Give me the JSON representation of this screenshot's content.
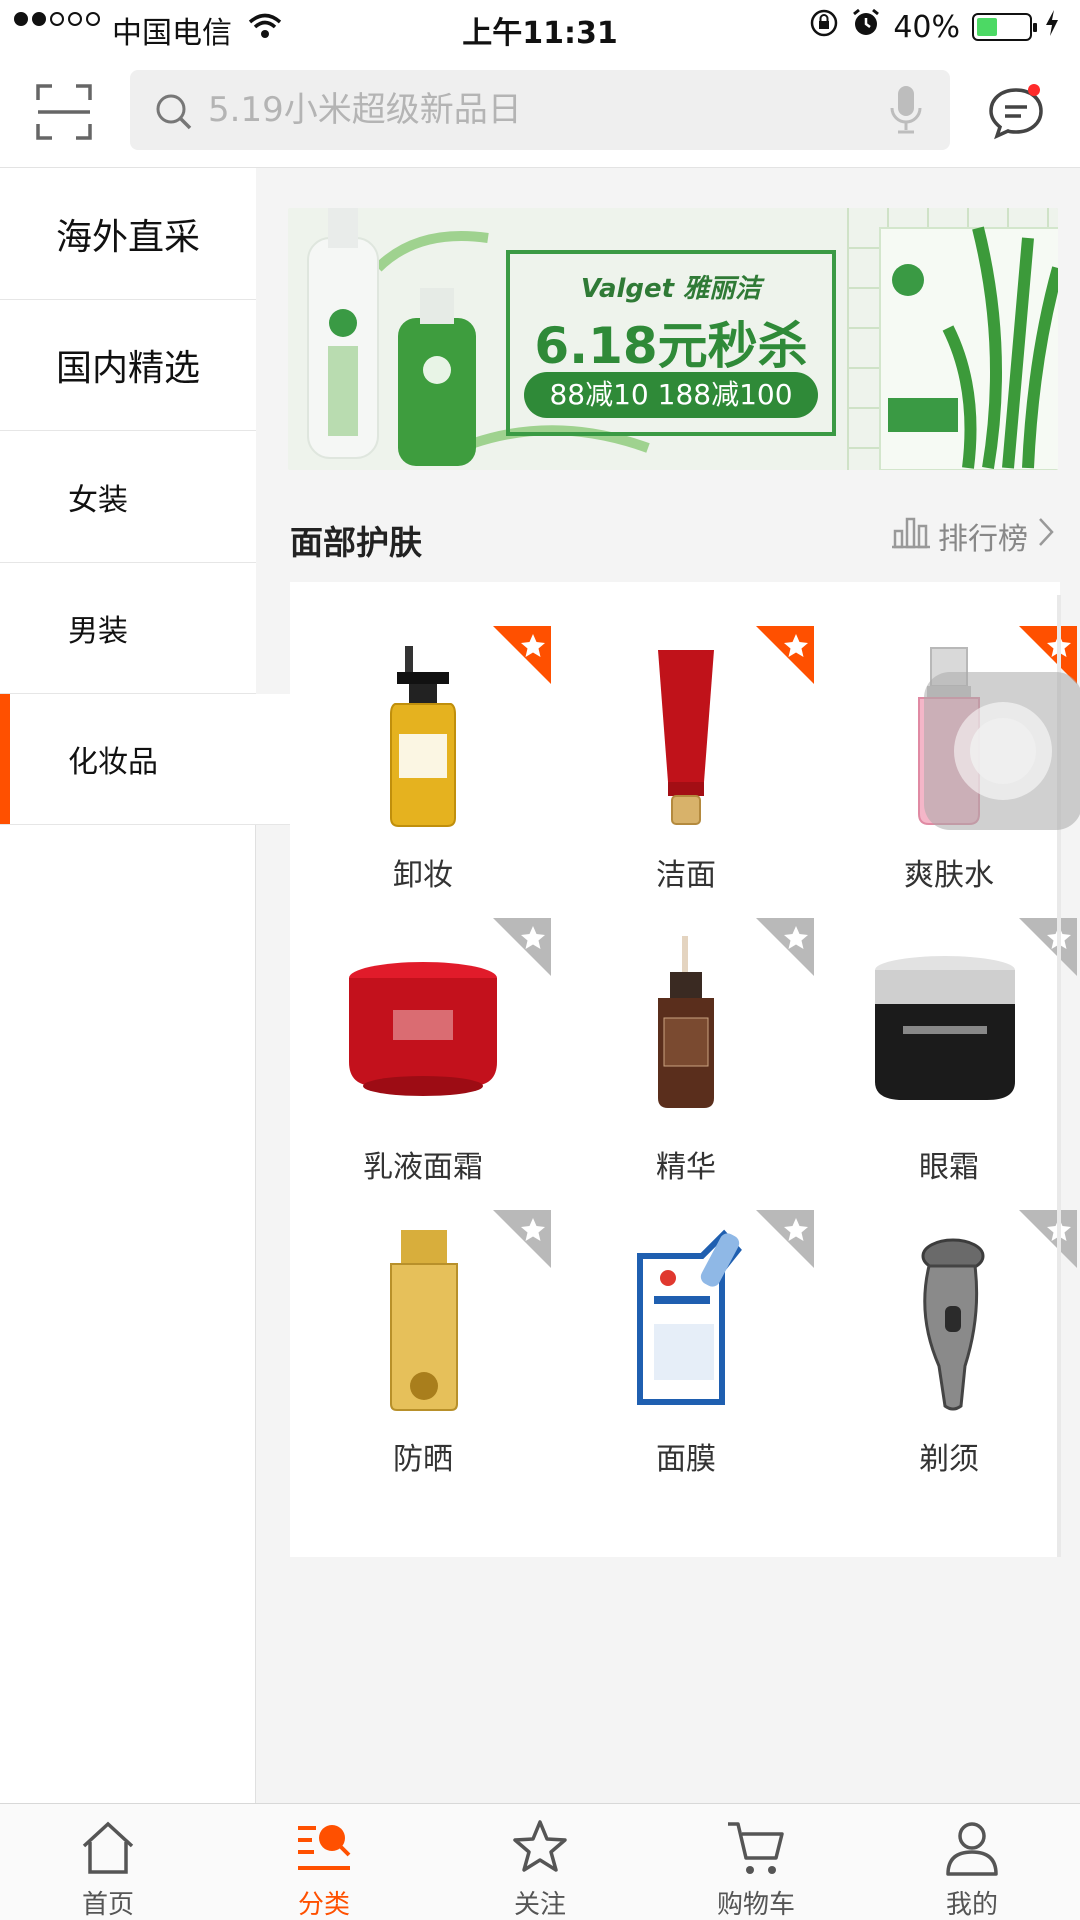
{
  "status_bar": {
    "signal": "●●○○○",
    "carrier": "中国电信",
    "time": "上午11:31",
    "battery": "40%",
    "battery_level": 0.4
  },
  "search": {
    "placeholder": "5.19小米超级新品日"
  },
  "sidebar": {
    "items": [
      {
        "label": "海外直采"
      },
      {
        "label": "国内精选"
      },
      {
        "label": "女装"
      },
      {
        "label": "男装"
      },
      {
        "label": "化妆品"
      }
    ],
    "active_index": 4
  },
  "banner": {
    "brand": "Valget 雅丽洁",
    "headline": "6.18元秒杀",
    "promo": "88减10 188减100"
  },
  "section": {
    "title": "面部护肤",
    "rank_label": "排行榜"
  },
  "categories": [
    {
      "label": "卸妆",
      "featured": true
    },
    {
      "label": "洁面",
      "featured": true
    },
    {
      "label": "爽肤水",
      "featured": true
    },
    {
      "label": "乳液面霜",
      "featured": false
    },
    {
      "label": "精华",
      "featured": false
    },
    {
      "label": "眼霜",
      "featured": false
    },
    {
      "label": "防晒",
      "featured": false
    },
    {
      "label": "面膜",
      "featured": false
    },
    {
      "label": "剃须",
      "featured": false
    }
  ],
  "tabbar": {
    "tabs": [
      {
        "label": "首页"
      },
      {
        "label": "分类"
      },
      {
        "label": "关注"
      },
      {
        "label": "购物车"
      },
      {
        "label": "我的"
      }
    ],
    "active_index": 1
  },
  "colors": {
    "accent": "#ff5000",
    "star_featured": "#ff5000",
    "star_normal": "#b9b9b9",
    "banner_green": "#2f8a38"
  }
}
